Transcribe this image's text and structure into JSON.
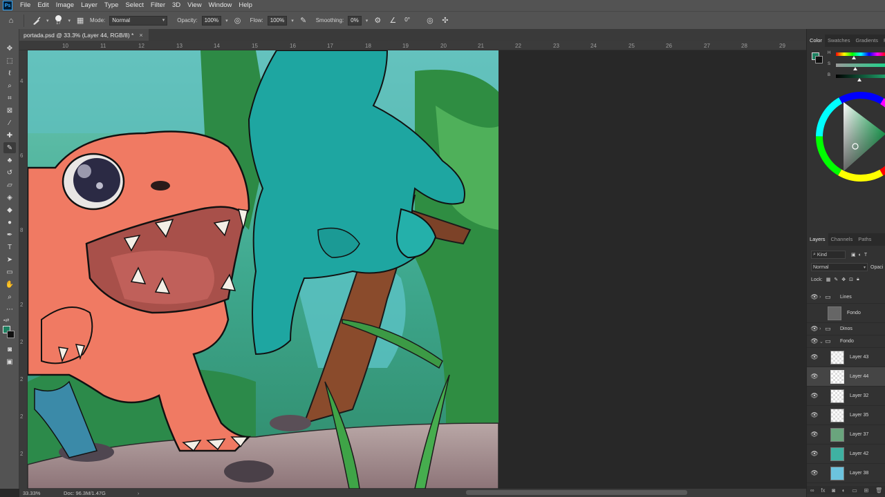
{
  "app": {
    "logo_text": "Ps"
  },
  "menu": [
    "File",
    "Edit",
    "Image",
    "Layer",
    "Type",
    "Select",
    "Filter",
    "3D",
    "View",
    "Window",
    "Help"
  ],
  "options": {
    "brush_size": "17",
    "mode_label": "Mode:",
    "mode_value": "Normal",
    "opacity_label": "Opacity:",
    "opacity_value": "100%",
    "flow_label": "Flow:",
    "flow_value": "100%",
    "smoothing_label": "Smoothing:",
    "smoothing_value": "0%",
    "angle_value": "0°"
  },
  "document": {
    "tab_title": "portada.psd @ 33.3% (Layer 44, RGB/8) *",
    "close": "×"
  },
  "ruler": {
    "top_ticks": [
      "10",
      "11",
      "12",
      "13",
      "14",
      "15",
      "16",
      "17",
      "18",
      "19",
      "20",
      "21",
      "22",
      "23",
      "24",
      "25",
      "26",
      "27",
      "28",
      "29"
    ],
    "left_ticks": [
      "4",
      "6",
      "8",
      "2",
      "2",
      "2",
      "2",
      "2"
    ]
  },
  "status": {
    "zoom": "33.33%",
    "doc_size": "Doc: 96.3M/1.47G",
    "arrow": "›"
  },
  "color_panel": {
    "tabs": [
      "Color",
      "Swatches",
      "Gradients",
      "P"
    ],
    "sliders": [
      {
        "label": "H",
        "position": 0.33
      },
      {
        "label": "S",
        "position": 0.37
      },
      {
        "label": "B",
        "position": 0.45
      }
    ],
    "foreground": "#1d8060",
    "background": "#111111"
  },
  "layers_panel": {
    "tabs": [
      "Layers",
      "Channels",
      "Paths"
    ],
    "filter_kind": "Kind",
    "blend_mode": "Normal",
    "opacity_label": "Opaci",
    "lock_label": "Lock:",
    "layers": [
      {
        "name": "Lines",
        "type": "group",
        "visible": true
      },
      {
        "name": "Fondo",
        "type": "layer",
        "visible": false
      },
      {
        "name": "Dinos",
        "type": "group",
        "visible": true
      },
      {
        "name": "Fondo",
        "type": "group",
        "visible": true
      },
      {
        "name": "Layer 43",
        "type": "layer",
        "visible": true
      },
      {
        "name": "Layer 44",
        "type": "layer",
        "visible": true,
        "selected": true
      },
      {
        "name": "Layer 32",
        "type": "layer",
        "visible": true
      },
      {
        "name": "Layer 35",
        "type": "layer",
        "visible": true
      },
      {
        "name": "Layer 37",
        "type": "layer",
        "visible": true
      },
      {
        "name": "Layer 42",
        "type": "layer",
        "visible": true
      },
      {
        "name": "Layer 38",
        "type": "layer",
        "visible": true
      }
    ]
  },
  "colors": {
    "accent": "#31a8ff",
    "chrome": "#535353",
    "canvas_bg": "#282828"
  }
}
